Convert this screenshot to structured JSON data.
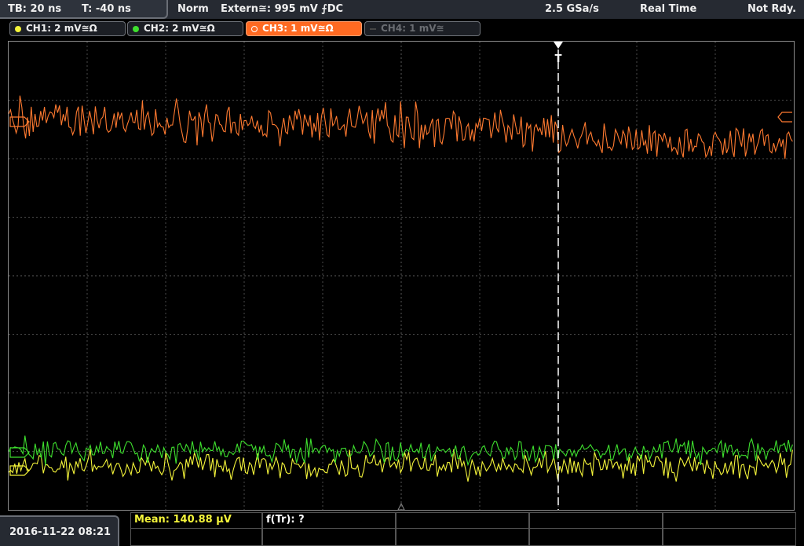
{
  "topbar": {
    "timebase": "TB: 20 ns",
    "trigger_time": "T: -40 ns",
    "trigger_mode": "Norm",
    "trigger_source": "Extern≅: 995 mV ⨍DC",
    "sample_rate": "2.5 GSa/s",
    "acq_mode": "Real Time",
    "status": "Not Rdy."
  },
  "channels": [
    {
      "label": "CH1: 2 mV≅Ω",
      "color": "#f4f43a",
      "state": "on"
    },
    {
      "label": "CH2: 2 mV≅Ω",
      "color": "#3ee02e",
      "state": "on"
    },
    {
      "label": "CH3: 1 mV≅Ω",
      "color": "#ff6a22",
      "state": "active"
    },
    {
      "label": "CH4: 1 mV≅",
      "color": "#555555",
      "state": "off"
    }
  ],
  "markers": {
    "trigger_label": "T"
  },
  "bottom": {
    "datetime": "2016-11-22 08:21",
    "meas1": "Mean: 140.88 µV",
    "meas2": "f(Tr): ?"
  },
  "colors": {
    "ch1": "#f4f43a",
    "ch2": "#3ee02e",
    "ch3": "#ff7a30",
    "grid": "#4a4a4a"
  }
}
